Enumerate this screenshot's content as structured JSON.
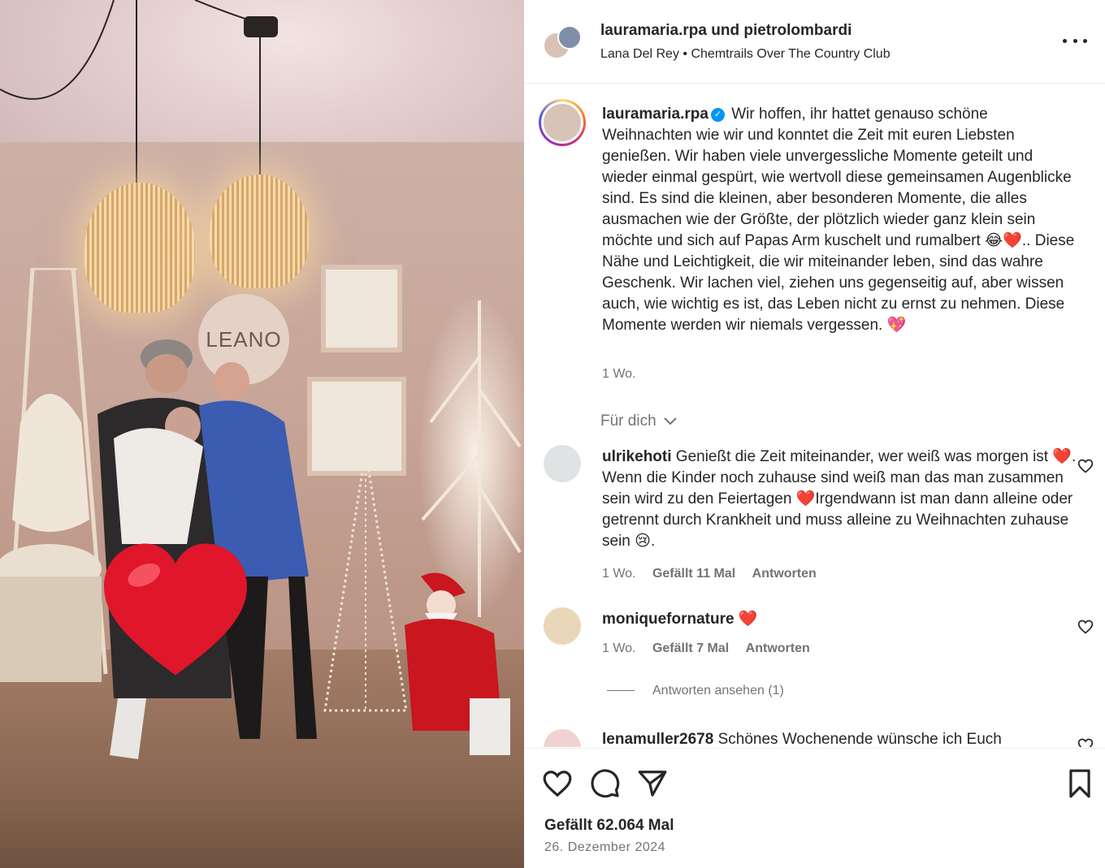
{
  "header": {
    "title": "lauramaria.rpa und pietrolombardi",
    "music_artist": "Lana Del Rey",
    "music_separator": "•",
    "music_track": "Chemtrails Over The Country Club"
  },
  "media": {
    "sign_text": "LEANO"
  },
  "caption": {
    "username": "lauramaria.rpa",
    "text_part1": "Wir hoffen, ihr hattet genauso schöne Weihnachten wie wir und konntet die Zeit mit euren Liebsten genießen. Wir haben viele unvergessliche Momente geteilt und wieder einmal gespürt, wie wertvoll diese gemeinsamen Augenblicke sind. Es sind die kleinen, aber besonderen Momente, die alles ausmachen wie der Größte, der plötzlich wieder ganz klein sein möchte und sich auf Papas Arm kuschelt und rumalbert ",
    "emoji1": "😂❤️",
    "text_part2": ".. Diese Nähe und Leichtigkeit, die wir miteinander leben, sind das wahre Geschenk. Wir lachen viel, ziehen uns gegenseitig auf, aber wissen auch, wie wichtig es ist, das Leben nicht zu ernst zu nehmen. Diese Momente werden wir niemals vergessen. ",
    "emoji2": "💖",
    "time": "1 Wo."
  },
  "for_you": "Für dich",
  "comments": [
    {
      "username": "ulrikehoti",
      "text": "Genießt die Zeit miteinander, wer weiß was morgen ist ❤️. Wenn die Kinder noch zuhause sind weiß man das man zusammen sein wird zu den Feiertagen ❤️Irgendwann ist man dann alleine oder getrennt durch Krankheit und muss alleine zu Weihnachten zuhause sein 😢.",
      "time": "1 Wo.",
      "likes": "Gefällt 11 Mal",
      "reply": "Antworten"
    },
    {
      "username": "moniquefornature",
      "text": "❤️",
      "time": "1 Wo.",
      "likes": "Gefällt 7 Mal",
      "reply": "Antworten",
      "view_replies": "Antworten ansehen (1)"
    },
    {
      "username": "lenamuller2678",
      "text": "Schönes Wochenende wünsche ich Euch"
    }
  ],
  "footer": {
    "likes": "Gefällt 62.064 Mal",
    "date": "26. Dezember 2024"
  },
  "colors": {
    "verified": "#0095f6",
    "muted_text": "#737373",
    "heart_red": "#e0162b"
  }
}
